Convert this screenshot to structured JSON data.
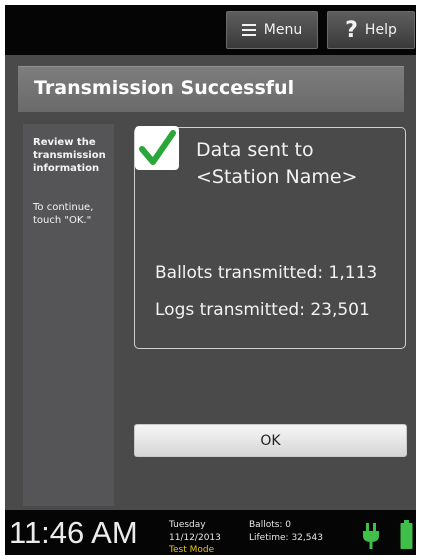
{
  "header": {
    "menu_label": "Menu",
    "help_label": "Help"
  },
  "screen": {
    "title": "Transmission Successful"
  },
  "sidebar": {
    "heading": "Review the transmission information",
    "instruction": "To continue, touch \"OK.\""
  },
  "summary": {
    "sent_line1": "Data sent to",
    "sent_line2": "<Station Name>",
    "ballots": "Ballots transmitted: 1,113",
    "logs": "Logs transmitted: 23,501"
  },
  "actions": {
    "ok_label": "OK"
  },
  "status": {
    "time": "11:46 AM",
    "day": "Tuesday",
    "date": "11/12/2013",
    "mode": "Test Mode",
    "ballots": "Ballots:  0",
    "lifetime": "Lifetime: 32,543"
  },
  "icons": {
    "check": "check-icon",
    "menu": "menu-icon",
    "help": "help-icon",
    "plug": "power-plug-icon",
    "battery": "battery-icon"
  },
  "colors": {
    "check_green": "#2aa63a",
    "power_green": "#3fbf4a",
    "test_mode": "#e8c11e"
  }
}
